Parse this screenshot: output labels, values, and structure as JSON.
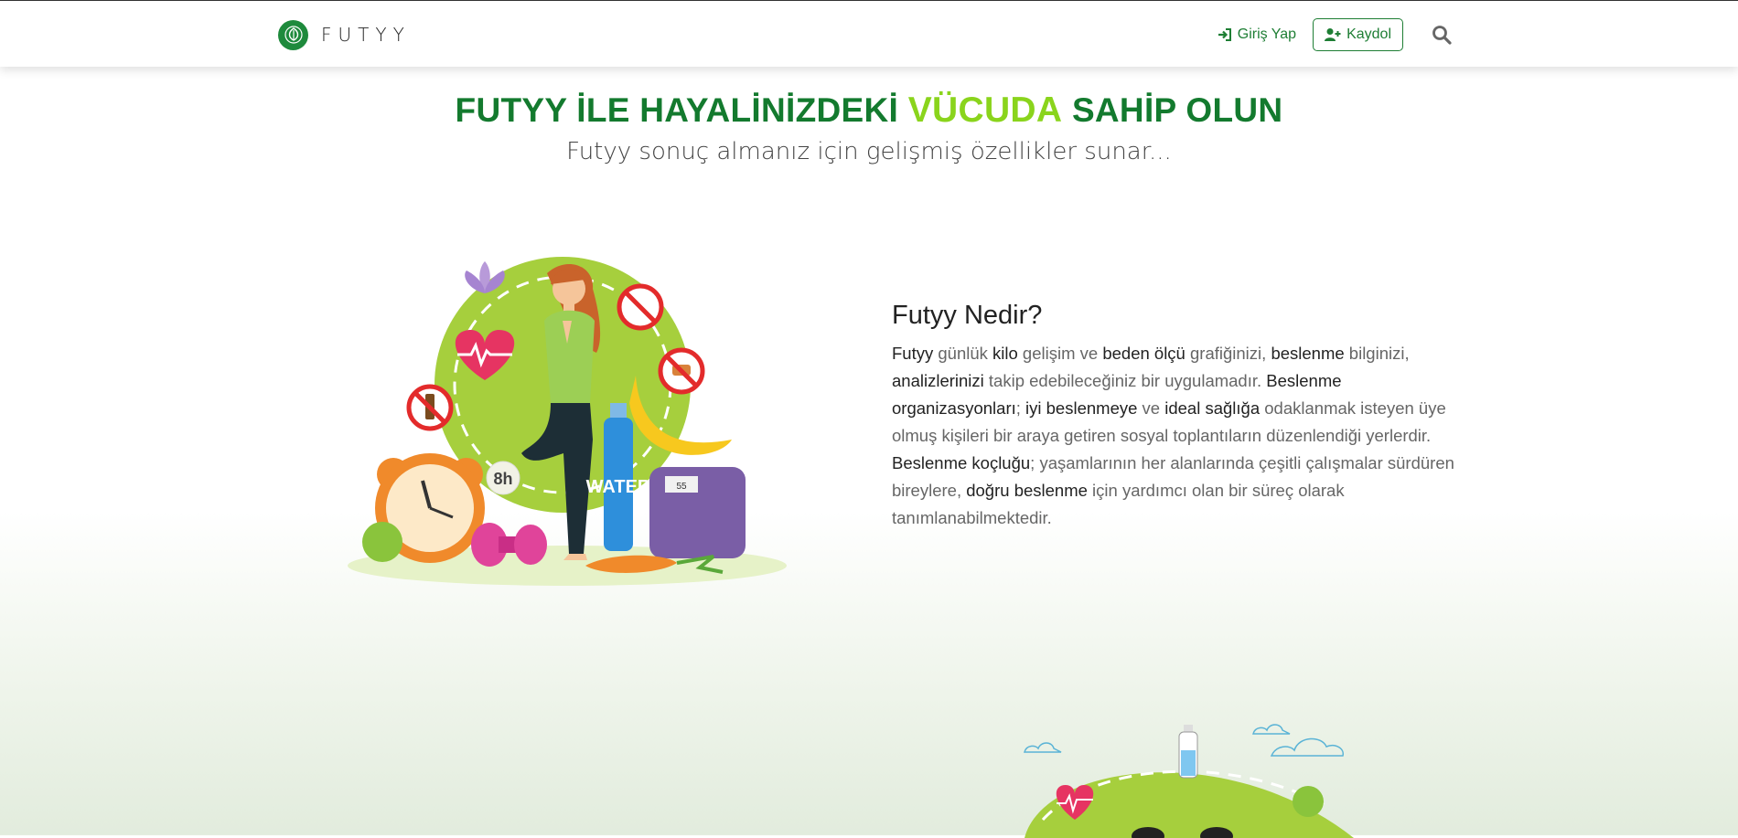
{
  "nav": {
    "brand": "FUTYY",
    "login_label": "Giriş Yap",
    "signup_label": "Kaydol"
  },
  "hero": {
    "title_part1": "FUTYY İLE HAYALİNİZDEKİ",
    "title_accent": "VÜCUDA",
    "title_part2": "SAHİP OLUN",
    "subtitle": "Futyy sonuç almanız için gelişmiş özellikler sunar..."
  },
  "about": {
    "heading": "Futyy Nedir?",
    "paragraph": [
      {
        "t": "Futyy",
        "b": true
      },
      {
        "t": " günlük ",
        "b": false
      },
      {
        "t": "kilo",
        "b": true
      },
      {
        "t": " gelişim ve ",
        "b": false
      },
      {
        "t": "beden ölçü",
        "b": true
      },
      {
        "t": " grafiğinizi, ",
        "b": false
      },
      {
        "t": "beslenme",
        "b": true
      },
      {
        "t": " bilginizi, ",
        "b": false
      },
      {
        "t": "analizlerinizi",
        "b": true
      },
      {
        "t": " takip edebileceğiniz bir uygulamadır. ",
        "b": false
      },
      {
        "t": "Beslenme organizasyonları",
        "b": true
      },
      {
        "t": "; ",
        "b": false
      },
      {
        "t": "iyi beslenmeye",
        "b": true
      },
      {
        "t": " ve ",
        "b": false
      },
      {
        "t": "ideal sağlığa",
        "b": true
      },
      {
        "t": " odaklanmak isteyen üye olmuş kişileri bir araya getiren sosyal toplantıların düzenlendiği yerlerdir. ",
        "b": false
      },
      {
        "t": "Beslenme koçluğu",
        "b": true
      },
      {
        "t": "; yaşamlarının her alanlarında çeşitli çalışmalar sürdüren bireylere, ",
        "b": false
      },
      {
        "t": "doğru beslenme",
        "b": true
      },
      {
        "t": " için yardımcı olan bir süreç olarak tanımlanabilmektedir.",
        "b": false
      }
    ]
  },
  "illustration": {
    "clock_label": "8h",
    "bottle_label": "WATER",
    "scale_reading": "55"
  },
  "icons": [
    "leaf-logo-icon",
    "sign-in-icon",
    "user-plus-icon",
    "search-icon"
  ],
  "colors": {
    "brand_green": "#1e7e34",
    "title_green": "#137a2e",
    "accent_lime": "#8ad41c"
  }
}
